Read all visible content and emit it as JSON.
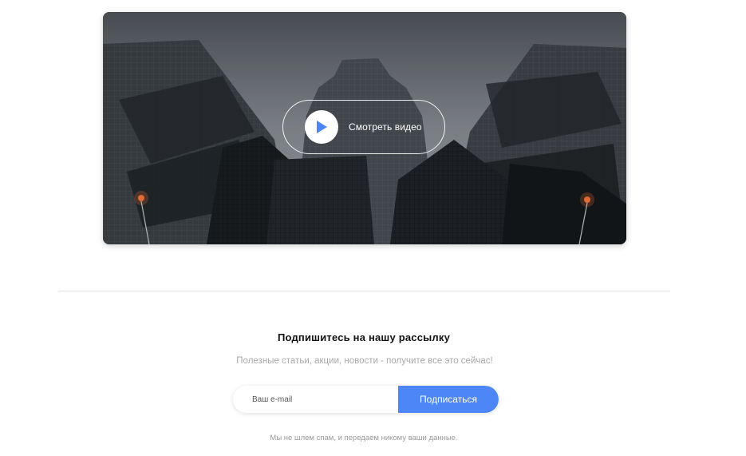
{
  "video": {
    "play_label": "Смотреть видео",
    "accent_color": "#4d87f7"
  },
  "newsletter": {
    "title": "Подпишитесь на нашу рассылку",
    "subtitle": "Полезные статьи, акции, новости - получите все это сейчас!",
    "email_placeholder": "Ваш e-mail",
    "subscribe_label": "Подписаться",
    "note": "Мы не шлем спам, и передаем никому ваши данные."
  }
}
